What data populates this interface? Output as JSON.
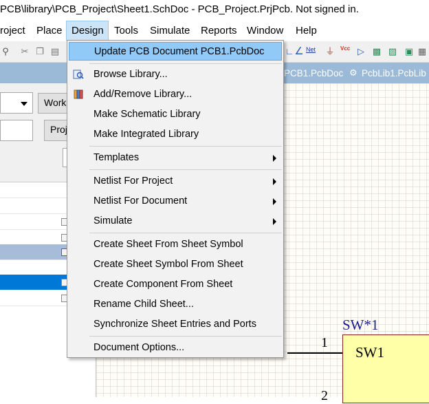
{
  "window": {
    "title": "PCB\\library\\PCB_Project\\Sheet1.SchDoc - PCB_Project.PrjPcb. Not signed in."
  },
  "menubar": {
    "items": [
      "roject",
      "Place",
      "Design",
      "Tools",
      "Simulate",
      "Reports",
      "Window",
      "Help"
    ],
    "active": "Design"
  },
  "toolbar": {
    "net_label": "Net",
    "vcc_label": "Vcc"
  },
  "left_panel": {
    "dropdown_value": "",
    "workspace_button": "Work",
    "project_button": "Proj"
  },
  "doc_tabs": [
    "PCB1.PcbDoc",
    "PcbLib1.PcbLib"
  ],
  "design_menu": {
    "items": [
      {
        "label": "Update PCB Document PCB1.PcbDoc",
        "highlighted": true
      },
      {
        "label": "Browse Library...",
        "icon": "library-browse-icon"
      },
      {
        "label": "Add/Remove Library...",
        "icon": "library-books-icon"
      },
      {
        "label": "Make Schematic Library"
      },
      {
        "label": "Make Integrated Library"
      },
      {
        "label": "Templates",
        "submenu": true
      },
      {
        "label": "Netlist For Project",
        "submenu": true
      },
      {
        "label": "Netlist For Document",
        "submenu": true
      },
      {
        "label": "Simulate",
        "submenu": true
      },
      {
        "label": "Create Sheet From Sheet Symbol"
      },
      {
        "label": "Create Sheet Symbol From Sheet"
      },
      {
        "label": "Create Component From Sheet"
      },
      {
        "label": "Rename Child Sheet..."
      },
      {
        "label": "Synchronize Sheet Entries and Ports"
      },
      {
        "label": "Document Options..."
      }
    ]
  },
  "schematic": {
    "component_designator": "SW*1",
    "component_name": "SW1",
    "pin1_number": "1",
    "pin2_number": "2"
  },
  "colors": {
    "menu_highlight": "#91c9f7",
    "panel_header": "#9bbad7",
    "component_fill": "#ffffa8",
    "designator_text": "#1a1a8c",
    "tree_selection": "#0078d7"
  }
}
